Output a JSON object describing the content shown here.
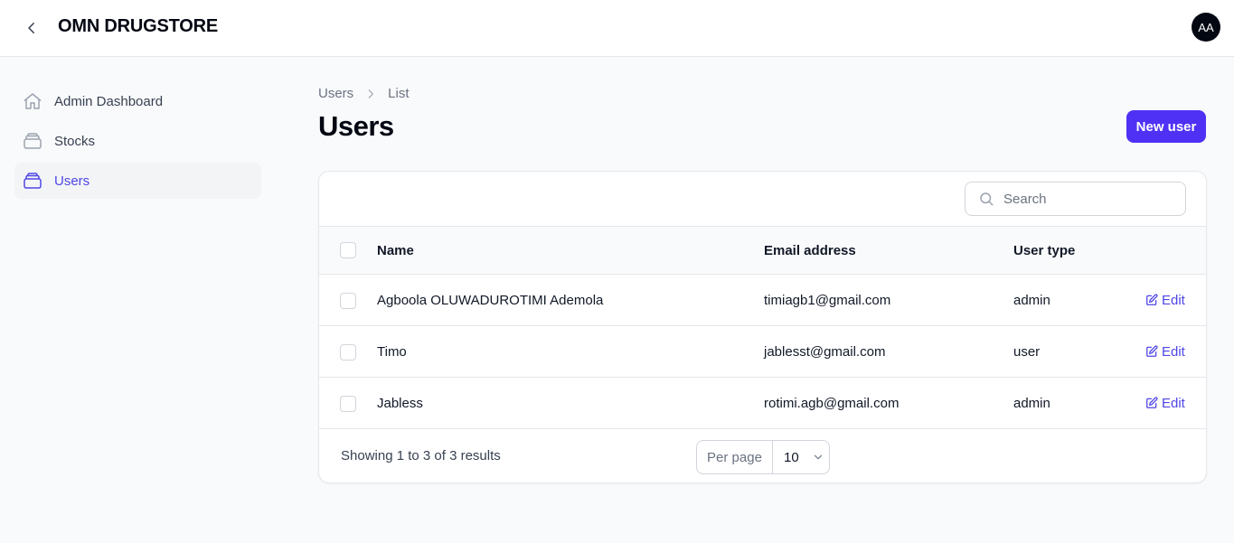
{
  "header": {
    "brand": "OMN DRUGSTORE",
    "avatar_initials": "AA"
  },
  "sidebar": {
    "items": [
      {
        "label": "Admin Dashboard",
        "icon": "home-icon"
      },
      {
        "label": "Stocks",
        "icon": "stack-icon"
      },
      {
        "label": "Users",
        "icon": "stack-icon",
        "active": true
      }
    ]
  },
  "breadcrumb": {
    "items": [
      "Users",
      "List"
    ]
  },
  "page": {
    "title": "Users",
    "new_button": "New user"
  },
  "table": {
    "search_placeholder": "Search",
    "columns": [
      "Name",
      "Email address",
      "User type"
    ],
    "rows": [
      {
        "name": "Agboola OLUWADUROTIMI Ademola",
        "email": "timiagb1@gmail.com",
        "type": "admin",
        "action": "Edit"
      },
      {
        "name": "Timo",
        "email": "jablesst@gmail.com",
        "type": "user",
        "action": "Edit"
      },
      {
        "name": "Jabless",
        "email": "rotimi.agb@gmail.com",
        "type": "admin",
        "action": "Edit"
      }
    ],
    "footer": {
      "summary": "Showing 1 to 3 of 3 results",
      "per_page_label": "Per page",
      "per_page_value": "10"
    }
  },
  "colors": {
    "accent": "#4f31f5",
    "link": "#4f46e5"
  }
}
